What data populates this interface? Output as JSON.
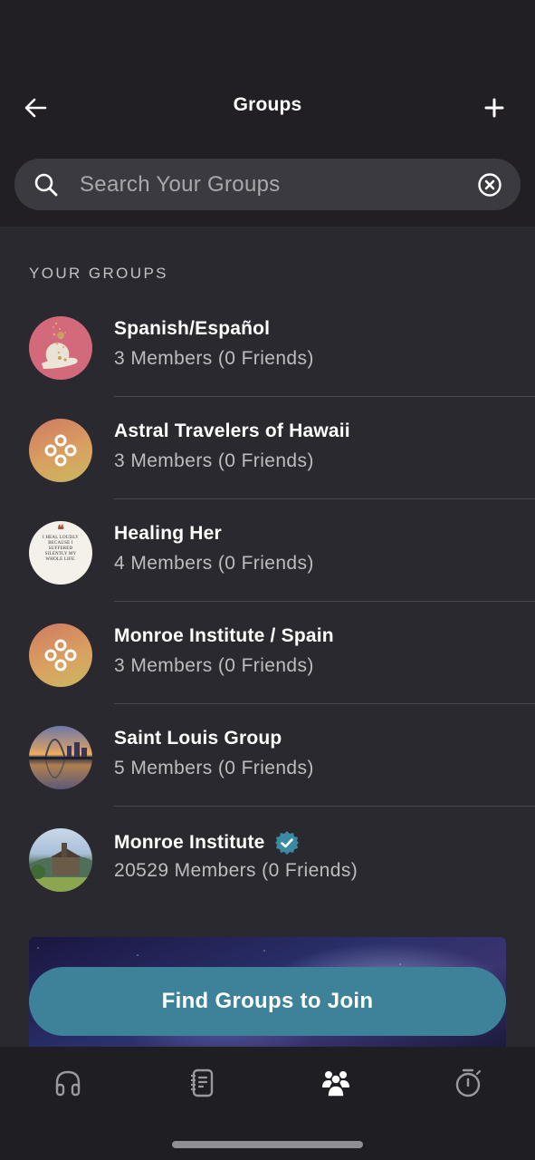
{
  "header": {
    "title": "Groups",
    "back_icon": "arrow-left-icon",
    "add_icon": "plus-icon"
  },
  "search": {
    "placeholder": "Search Your Groups",
    "value": "",
    "search_icon": "search-icon",
    "clear_icon": "clear-circle-x-icon"
  },
  "section": {
    "title": "YOUR GROUPS"
  },
  "groups": [
    {
      "name": "Spanish/Español",
      "meta": "3 Members (0 Friends)",
      "avatar": "photo-hand-gold-flakes",
      "verified": false
    },
    {
      "name": "Astral Travelers of Hawaii",
      "meta": "3 Members (0 Friends)",
      "avatar": "default-group-rings",
      "verified": false
    },
    {
      "name": "Healing Her",
      "meta": "4 Members (0 Friends)",
      "avatar": "quote-card",
      "verified": false
    },
    {
      "name": "Monroe Institute / Spain",
      "meta": "3 Members (0 Friends)",
      "avatar": "default-group-rings",
      "verified": false
    },
    {
      "name": "Saint Louis Group",
      "meta": "5 Members (0 Friends)",
      "avatar": "photo-st-louis-arch",
      "verified": false
    },
    {
      "name": "Monroe Institute",
      "meta": "20529 Members (0 Friends)",
      "avatar": "photo-institute-building",
      "verified": true
    }
  ],
  "quote_card": {
    "text": "I HEAL LOUDLY BECAUSE I SUFFERED SILENTLY MY WHOLE LIFE.",
    "mark": "❝"
  },
  "find_button": {
    "label": "Find Groups to Join"
  },
  "tabbar": {
    "items": [
      {
        "name": "listen",
        "icon": "headphones-icon",
        "active": false
      },
      {
        "name": "journal",
        "icon": "journal-icon",
        "active": false
      },
      {
        "name": "groups",
        "icon": "people-group-icon",
        "active": true
      },
      {
        "name": "timer",
        "icon": "stopwatch-icon",
        "active": false
      }
    ]
  },
  "colors": {
    "header_bg": "#211f24",
    "body_bg": "#2a292f",
    "accent": "#3d8299",
    "verified": "#3b8aa3",
    "tab_active": "#ffffff",
    "tab_inactive": "#9a999e"
  }
}
